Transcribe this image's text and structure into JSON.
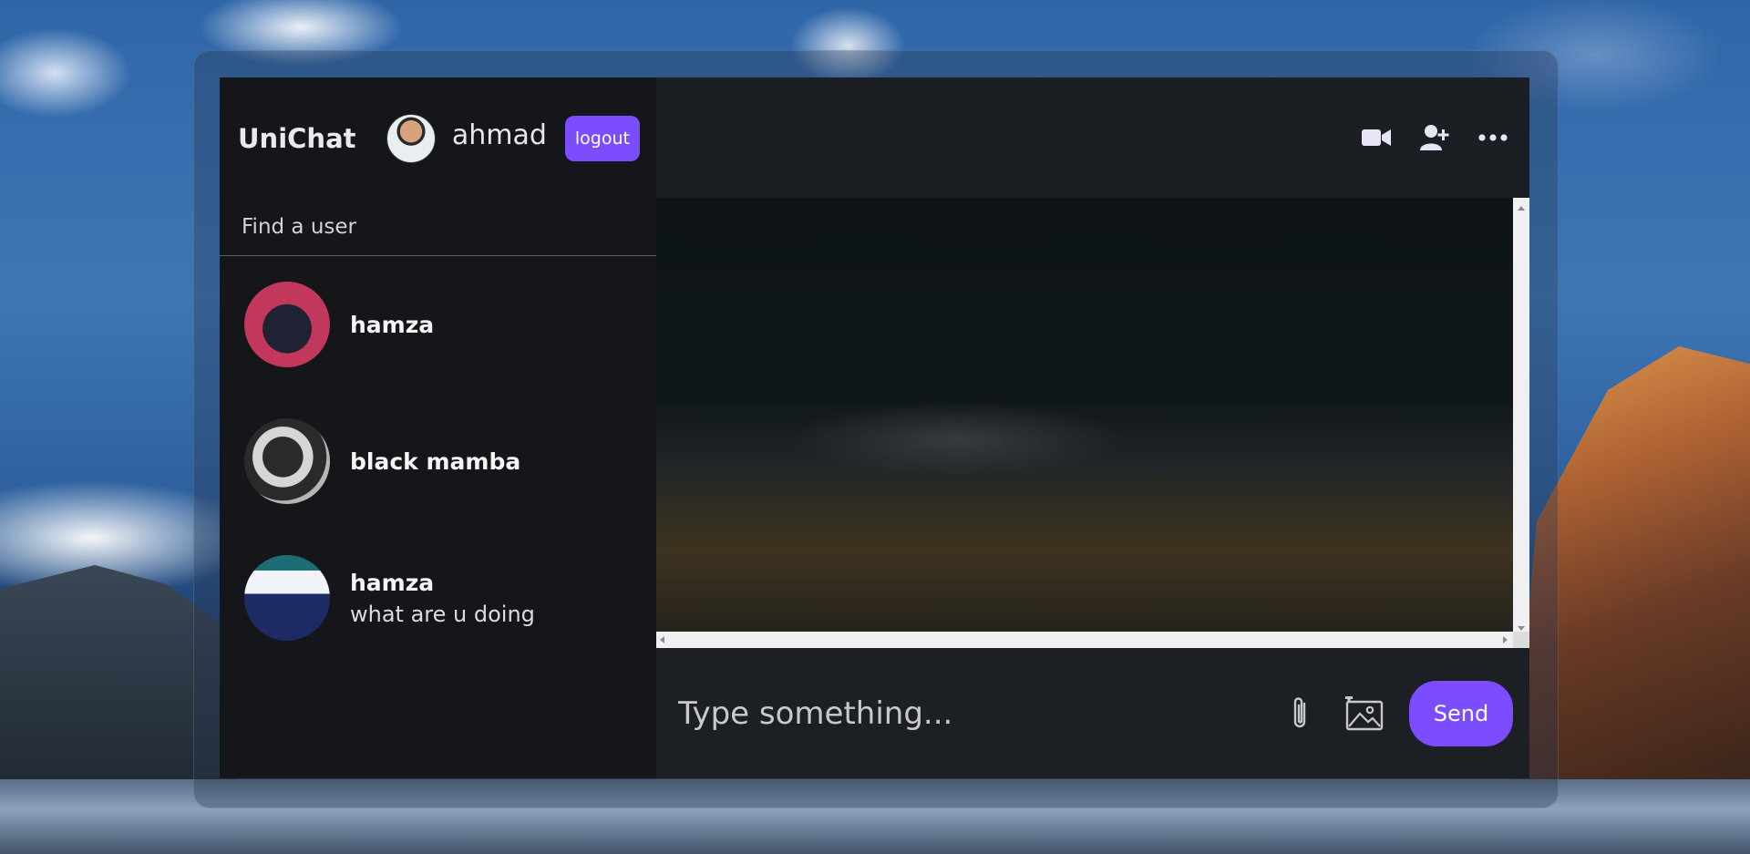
{
  "app": {
    "brand": "UniChat",
    "current_user": {
      "name": "ahmad"
    },
    "logout_label": "logout"
  },
  "search": {
    "placeholder": "Find a user"
  },
  "chats": [
    {
      "name": "hamza",
      "preview": ""
    },
    {
      "name": "black mamba",
      "preview": ""
    },
    {
      "name": "hamza",
      "preview": "what are u doing"
    }
  ],
  "header_icons": [
    "video-camera-icon",
    "add-user-icon",
    "more-options-icon"
  ],
  "composer": {
    "placeholder": "Type something...",
    "icons": [
      "attach-icon",
      "image-icon"
    ],
    "send_label": "Send"
  },
  "colors": {
    "accent": "#7c4dff",
    "sidebar_bg": "#141619",
    "header_bg": "#1b1e22",
    "composer_bg": "#1c1f23"
  }
}
